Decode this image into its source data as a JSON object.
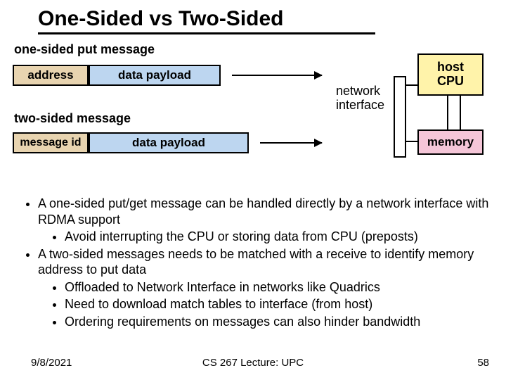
{
  "title": "One-Sided vs Two-Sided",
  "section1": "one-sided put message",
  "msg1": {
    "left": "address",
    "right": "data payload"
  },
  "section2": "two-sided message",
  "msg2": {
    "left": "message id",
    "right": "data payload"
  },
  "ni": {
    "line1": "network",
    "line2": "interface"
  },
  "host": {
    "cpu1": "host",
    "cpu2": "CPU",
    "mem": "memory"
  },
  "bullets": {
    "b1": "A one-sided put/get message can be handled directly by a network interface with RDMA support",
    "b1a": "Avoid interrupting the CPU or storing data from CPU (preposts)",
    "b2": "A two-sided messages needs to be matched with a receive to identify memory address to put data",
    "b2a": "Offloaded to Network Interface in networks like Quadrics",
    "b2b": "Need to download match tables to interface (from host)",
    "b2c": "Ordering requirements on messages can also hinder bandwidth"
  },
  "footer": {
    "date": "9/8/2021",
    "center": "CS 267 Lecture: UPC",
    "page": "58"
  }
}
